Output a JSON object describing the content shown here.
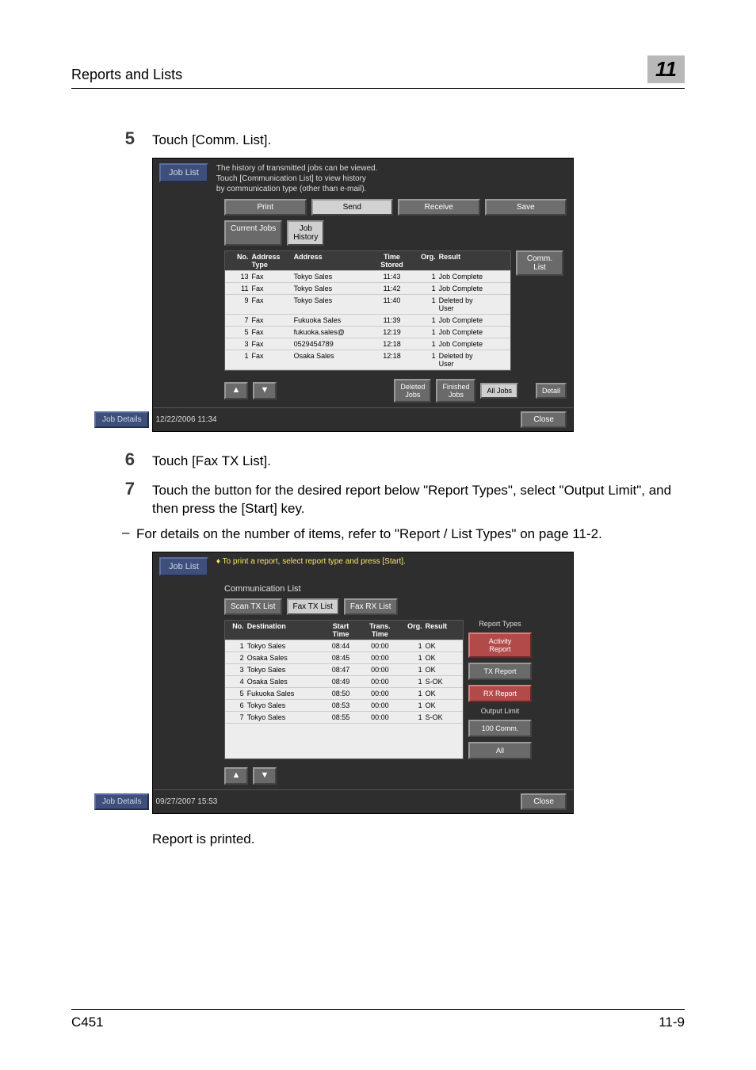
{
  "header": {
    "title": "Reports and Lists",
    "chapter": "11"
  },
  "steps": {
    "s5": {
      "num": "5",
      "text": "Touch [Comm. List]."
    },
    "s6": {
      "num": "6",
      "text": "Touch [Fax TX List]."
    },
    "s7": {
      "num": "7",
      "text": "Touch the button for the desired report below \"Report Types\", select \"Output Limit\", and then press the [Start] key."
    },
    "s7sub": "For details on the number of items, refer to \"Report / List Types\" on page 11-2.",
    "result": "Report is printed."
  },
  "screen1": {
    "joblist": "Job List",
    "hint": "The history of transmitted jobs can be viewed.\nTouch [Communication List] to view history\nby communication type (other than e-mail).",
    "tabs": {
      "print": "Print",
      "send": "Send",
      "receive": "Receive",
      "save": "Save"
    },
    "subtabs": {
      "current": "Current Jobs",
      "history": "Job\nHistory"
    },
    "comm": "Comm.\nList",
    "cols": {
      "no": "No.",
      "type": "Address\nType",
      "address": "Address",
      "time": "Time\nStored",
      "org": "Org.",
      "result": "Result"
    },
    "rows": [
      {
        "no": "13",
        "type": "Fax",
        "addr": "Tokyo Sales",
        "time": "11:43",
        "org": "1",
        "res": "Job Complete"
      },
      {
        "no": "11",
        "type": "Fax",
        "addr": "Tokyo Sales",
        "time": "11:42",
        "org": "1",
        "res": "Job Complete"
      },
      {
        "no": "9",
        "type": "Fax",
        "addr": "Tokyo Sales",
        "time": "11:40",
        "org": "1",
        "res": "Deleted by\nUser"
      },
      {
        "no": "7",
        "type": "Fax",
        "addr": "Fukuoka Sales",
        "time": "11:39",
        "org": "1",
        "res": "Job Complete"
      },
      {
        "no": "5",
        "type": "Fax",
        "addr": "fukuoka.sales@",
        "time": "12:19",
        "org": "1",
        "res": "Job Complete"
      },
      {
        "no": "3",
        "type": "Fax",
        "addr": "0529454789",
        "time": "12:18",
        "org": "1",
        "res": "Job Complete"
      },
      {
        "no": "1",
        "type": "Fax",
        "addr": "Osaka Sales",
        "time": "12:18",
        "org": "1",
        "res": "Deleted by\nUser"
      }
    ],
    "bottom": {
      "deleted": "Deleted\nJobs",
      "finished": "Finished\nJobs",
      "all": "All Jobs",
      "detail": "Detail"
    },
    "jobdetails": "Job Details",
    "datetime": "12/22/2006    11:34",
    "close": "Close"
  },
  "screen2": {
    "joblist": "Job List",
    "hint": "To print a report, select report type and press [Start].",
    "commtitle": "Communication List",
    "tabs": {
      "scan": "Scan TX List",
      "faxtx": "Fax TX List",
      "faxrx": "Fax RX List"
    },
    "cols": {
      "no": "No.",
      "dest": "Destination",
      "start": "Start\nTime",
      "time": "Trans.\nTime",
      "org": "Org.",
      "result": "Result"
    },
    "rows": [
      {
        "no": "1",
        "dest": "Tokyo Sales",
        "start": "08:44",
        "time": "00:00",
        "org": "1",
        "res": "OK"
      },
      {
        "no": "2",
        "dest": "Osaka Sales",
        "start": "08:45",
        "time": "00:00",
        "org": "1",
        "res": "OK"
      },
      {
        "no": "3",
        "dest": "Tokyo Sales",
        "start": "08:47",
        "time": "00:00",
        "org": "1",
        "res": "OK"
      },
      {
        "no": "4",
        "dest": "Osaka Sales",
        "start": "08:49",
        "time": "00:00",
        "org": "1",
        "res": "S-OK"
      },
      {
        "no": "5",
        "dest": "Fukuoka Sales",
        "start": "08:50",
        "time": "00:00",
        "org": "1",
        "res": "OK"
      },
      {
        "no": "6",
        "dest": "Tokyo Sales",
        "start": "08:53",
        "time": "00:00",
        "org": "1",
        "res": "OK"
      },
      {
        "no": "7",
        "dest": "Tokyo Sales",
        "start": "08:55",
        "time": "00:00",
        "org": "1",
        "res": "S-OK"
      }
    ],
    "side": {
      "rtypes": "Report Types",
      "activity": "Activity\nReport",
      "tx": "TX Report",
      "rx": "RX Report",
      "output": "Output\nLimit",
      "c100": "100 Comm.",
      "all": "All"
    },
    "jobdetails": "Job Details",
    "datetime": "09/27/2007    15:53",
    "close": "Close"
  },
  "footer": {
    "left": "C451",
    "right": "11-9"
  }
}
